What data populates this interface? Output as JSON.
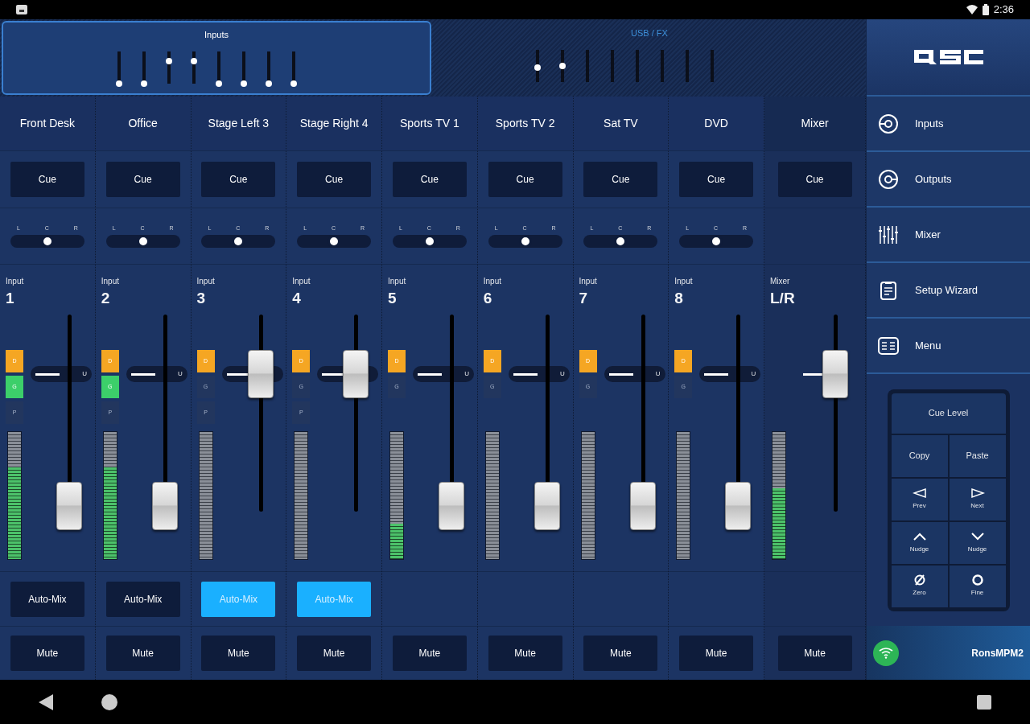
{
  "status_bar": {
    "time": "2:36"
  },
  "overview": [
    {
      "title": "Inputs",
      "selected": true,
      "faders": [
        {
          "kind": "thumb",
          "level": 0
        },
        {
          "kind": "thumb",
          "level": 0
        },
        {
          "kind": "thumb",
          "level": 0.78
        },
        {
          "kind": "thumb",
          "level": 0.78
        },
        {
          "kind": "thumb",
          "level": 0
        },
        {
          "kind": "thumb",
          "level": 0
        },
        {
          "kind": "thumb",
          "level": 0
        },
        {
          "kind": "thumb",
          "level": 0
        }
      ]
    },
    {
      "title": "USB / FX",
      "selected": false,
      "faders": [
        {
          "kind": "thumb",
          "level": 0.5
        },
        {
          "kind": "thumb",
          "level": 0.55
        },
        {
          "kind": "bare"
        },
        {
          "kind": "bare"
        },
        {
          "kind": "bare"
        },
        {
          "kind": "bare"
        },
        {
          "kind": "bare"
        },
        {
          "kind": "bare"
        }
      ]
    }
  ],
  "channels": [
    {
      "kind": "input",
      "name": "Front Desk",
      "cue": "Cue",
      "pan": {
        "labels": [
          "L",
          "C",
          "R"
        ],
        "level": 0.5
      },
      "type": "Input",
      "number": "1",
      "indicators": [
        {
          "kind": "d",
          "label": "D",
          "on": true
        },
        {
          "kind": "g",
          "label": "G",
          "on": true
        },
        {
          "kind": "p",
          "label": "P",
          "on": false
        }
      ],
      "meter": {
        "level": 0.72
      },
      "fader": {
        "level": 0.03,
        "unity": "U"
      },
      "automix": {
        "label": "Auto-Mix",
        "on": false
      },
      "mute": {
        "label": "Mute",
        "on": false
      }
    },
    {
      "kind": "input",
      "name": "Office",
      "cue": "Cue",
      "pan": {
        "labels": [
          "L",
          "C",
          "R"
        ],
        "level": 0.5
      },
      "type": "Input",
      "number": "2",
      "indicators": [
        {
          "kind": "d",
          "label": "D",
          "on": true
        },
        {
          "kind": "g",
          "label": "G",
          "on": true
        },
        {
          "kind": "p",
          "label": "P",
          "on": false
        }
      ],
      "meter": {
        "level": 0.72
      },
      "fader": {
        "level": 0.03,
        "unity": "U"
      },
      "automix": {
        "label": "Auto-Mix",
        "on": false
      },
      "mute": {
        "label": "Mute",
        "on": false
      }
    },
    {
      "kind": "input",
      "name": "Stage Left 3",
      "cue": "Cue",
      "pan": {
        "labels": [
          "L",
          "C",
          "R"
        ],
        "level": 0.5
      },
      "type": "Input",
      "number": "3",
      "indicators": [
        {
          "kind": "d",
          "label": "D",
          "on": true
        },
        {
          "kind": "g",
          "label": "G",
          "on": false
        },
        {
          "kind": "p",
          "label": "P",
          "on": false
        }
      ],
      "meter": {
        "level": 0
      },
      "fader": {
        "level": 0.7
      },
      "automix": {
        "label": "Auto-Mix",
        "on": true
      },
      "mute": {
        "label": "Mute",
        "on": false
      }
    },
    {
      "kind": "input",
      "name": "Stage Right 4",
      "cue": "Cue",
      "pan": {
        "labels": [
          "L",
          "C",
          "R"
        ],
        "level": 0.5
      },
      "type": "Input",
      "number": "4",
      "indicators": [
        {
          "kind": "d",
          "label": "D",
          "on": true
        },
        {
          "kind": "g",
          "label": "G",
          "on": false
        },
        {
          "kind": "p",
          "label": "P",
          "on": false
        }
      ],
      "meter": {
        "level": 0
      },
      "fader": {
        "level": 0.7
      },
      "automix": {
        "label": "Auto-Mix",
        "on": true
      },
      "mute": {
        "label": "Mute",
        "on": false
      }
    },
    {
      "kind": "input",
      "name": "Sports TV 1",
      "cue": "Cue",
      "pan": {
        "labels": [
          "L",
          "C",
          "R"
        ],
        "level": 0.5
      },
      "type": "Input",
      "number": "5",
      "indicators": [
        {
          "kind": "d",
          "label": "D",
          "on": true
        },
        {
          "kind": "g",
          "label": "G",
          "on": false
        }
      ],
      "meter": {
        "level": 0.28
      },
      "fader": {
        "level": 0.03,
        "unity": "U"
      },
      "mute": {
        "label": "Mute",
        "on": false
      }
    },
    {
      "kind": "input",
      "name": "Sports TV 2",
      "cue": "Cue",
      "pan": {
        "labels": [
          "L",
          "C",
          "R"
        ],
        "level": 0.5
      },
      "type": "Input",
      "number": "6",
      "indicators": [
        {
          "kind": "d",
          "label": "D",
          "on": true
        },
        {
          "kind": "g",
          "label": "G",
          "on": false
        }
      ],
      "meter": {
        "level": 0
      },
      "fader": {
        "level": 0.03,
        "unity": "U"
      },
      "mute": {
        "label": "Mute",
        "on": false
      }
    },
    {
      "kind": "input",
      "name": "Sat TV",
      "cue": "Cue",
      "pan": {
        "labels": [
          "L",
          "C",
          "R"
        ],
        "level": 0.5
      },
      "type": "Input",
      "number": "7",
      "indicators": [
        {
          "kind": "d",
          "label": "D",
          "on": true
        },
        {
          "kind": "g",
          "label": "G",
          "on": false
        }
      ],
      "meter": {
        "level": 0
      },
      "fader": {
        "level": 0.03,
        "unity": "U"
      },
      "mute": {
        "label": "Mute",
        "on": false
      }
    },
    {
      "kind": "input",
      "name": "DVD",
      "cue": "Cue",
      "pan": {
        "labels": [
          "L",
          "C",
          "R"
        ],
        "level": 0.5
      },
      "type": "Input",
      "number": "8",
      "indicators": [
        {
          "kind": "d",
          "label": "D",
          "on": true
        },
        {
          "kind": "g",
          "label": "G",
          "on": false
        }
      ],
      "meter": {
        "level": 0
      },
      "fader": {
        "level": 0.03,
        "unity": "U"
      },
      "mute": {
        "label": "Mute",
        "on": false
      }
    },
    {
      "kind": "mix",
      "name": "Mixer",
      "cue": "Cue",
      "type": "Mixer",
      "number": "L/R",
      "meter": {
        "level": 0.56
      },
      "fader": {
        "level": 0.7
      },
      "mute": {
        "label": "Mute",
        "on": false
      }
    }
  ],
  "sidebar": {
    "items": [
      {
        "kind": "inputs",
        "label": "Inputs"
      },
      {
        "kind": "outputs",
        "label": "Outputs"
      },
      {
        "kind": "mixer",
        "label": "Mixer"
      },
      {
        "kind": "wizard",
        "label": "Setup Wizard"
      },
      {
        "kind": "menu",
        "label": "Menu"
      }
    ],
    "panel": [
      {
        "kind": "wide",
        "label": "Cue Level"
      },
      {
        "kind": "text",
        "label": "Copy"
      },
      {
        "kind": "text",
        "label": "Paste"
      },
      {
        "kind": "prev",
        "label": "Prev"
      },
      {
        "kind": "next",
        "label": "Next"
      },
      {
        "kind": "up",
        "label": "Nudge"
      },
      {
        "kind": "down",
        "label": "Nudge"
      },
      {
        "kind": "zero",
        "label": "Zero"
      },
      {
        "kind": "fine",
        "label": "Fine"
      }
    ],
    "device": {
      "name": "RonsMPM2",
      "connected": true
    }
  }
}
